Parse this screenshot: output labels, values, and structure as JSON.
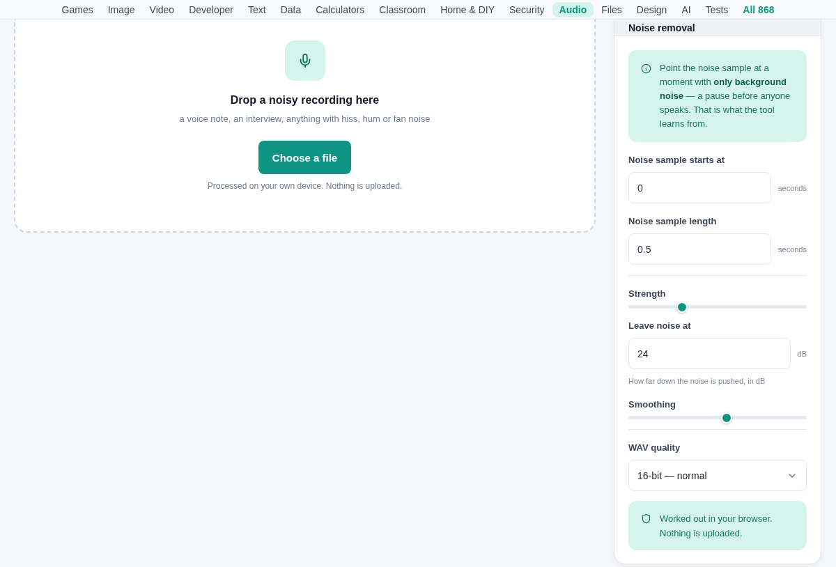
{
  "nav": {
    "items": [
      {
        "label": "Games",
        "kind": "category",
        "selected": false
      },
      {
        "label": "Image",
        "kind": "category",
        "selected": false
      },
      {
        "label": "Video",
        "kind": "category",
        "selected": false
      },
      {
        "label": "Developer",
        "kind": "category",
        "selected": false
      },
      {
        "label": "Text",
        "kind": "category",
        "selected": false
      },
      {
        "label": "Data",
        "kind": "category",
        "selected": false
      },
      {
        "label": "Calculators",
        "kind": "category",
        "selected": false
      },
      {
        "label": "Classroom",
        "kind": "category",
        "selected": false
      },
      {
        "label": "Home & DIY",
        "kind": "category",
        "selected": false
      },
      {
        "label": "Security",
        "kind": "category",
        "selected": false
      },
      {
        "label": "Audio",
        "kind": "category",
        "selected": true
      },
      {
        "label": "Files",
        "kind": "category",
        "selected": false
      },
      {
        "label": "Design",
        "kind": "category",
        "selected": false
      },
      {
        "label": "AI",
        "kind": "category",
        "selected": false
      },
      {
        "label": "Tests",
        "kind": "category",
        "selected": false
      },
      {
        "label": "All 868",
        "kind": "all",
        "selected": false
      }
    ]
  },
  "dropzone": {
    "title": "Drop a noisy recording here",
    "subtitle": "a voice note, an interview, anything with hiss, hum or fan noise",
    "button": "Choose a file",
    "note": "Processed on your own device. Nothing is uploaded."
  },
  "panel": {
    "title": "Noise removal",
    "controls": [
      {
        "kind": "tip",
        "text": "Point the noise sample at a moment with **only background noise** — a pause before anyone speaks. That is what the tool learns from."
      },
      {
        "kind": "number",
        "label": "Noise sample starts at",
        "value": "0",
        "unit": "seconds"
      },
      {
        "kind": "number",
        "label": "Noise sample length",
        "value": "0.5",
        "unit": "seconds"
      },
      {
        "kind": "divider"
      },
      {
        "kind": "slider",
        "label": "Strength",
        "level": 0.3
      },
      {
        "kind": "number",
        "label": "Leave noise at",
        "value": "24",
        "unit": "dB",
        "help": "How far down the noise is pushed, in dB"
      },
      {
        "kind": "slider",
        "label": "Smoothing",
        "level": 0.55
      },
      {
        "kind": "divider"
      },
      {
        "kind": "select",
        "label": "WAV quality",
        "value": "16-bit — normal"
      },
      {
        "kind": "assurance",
        "text": "Worked out in your browser. Nothing is uploaded."
      }
    ]
  }
}
